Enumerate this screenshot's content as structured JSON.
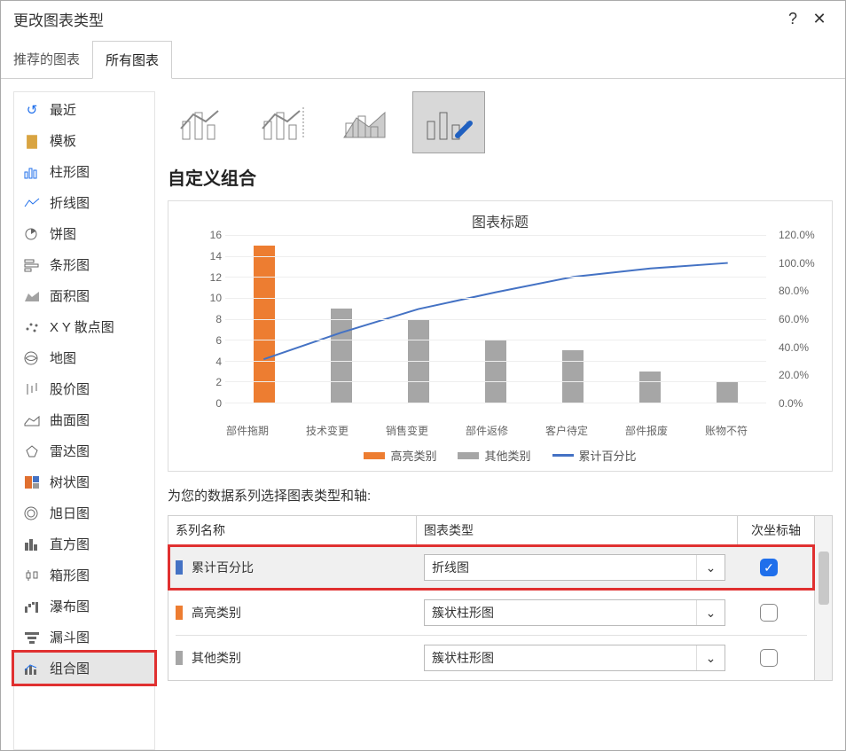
{
  "window": {
    "title": "更改图表类型",
    "help": "?",
    "close": "✕"
  },
  "tabs": {
    "recommended": "推荐的图表",
    "all": "所有图表"
  },
  "sidebar": {
    "items": [
      {
        "label": "最近",
        "key": "recent"
      },
      {
        "label": "模板",
        "key": "templates"
      },
      {
        "label": "柱形图",
        "key": "column"
      },
      {
        "label": "折线图",
        "key": "line"
      },
      {
        "label": "饼图",
        "key": "pie"
      },
      {
        "label": "条形图",
        "key": "bar"
      },
      {
        "label": "面积图",
        "key": "area"
      },
      {
        "label": "X Y 散点图",
        "key": "scatter"
      },
      {
        "label": "地图",
        "key": "map"
      },
      {
        "label": "股价图",
        "key": "stock"
      },
      {
        "label": "曲面图",
        "key": "surface"
      },
      {
        "label": "雷达图",
        "key": "radar"
      },
      {
        "label": "树状图",
        "key": "treemap"
      },
      {
        "label": "旭日图",
        "key": "sunburst"
      },
      {
        "label": "直方图",
        "key": "histogram"
      },
      {
        "label": "箱形图",
        "key": "box"
      },
      {
        "label": "瀑布图",
        "key": "waterfall"
      },
      {
        "label": "漏斗图",
        "key": "funnel"
      },
      {
        "label": "组合图",
        "key": "combo"
      }
    ]
  },
  "section_title": "自定义组合",
  "preview": {
    "title": "图表标题",
    "legend": {
      "highlight": "高亮类别",
      "other": "其他类别",
      "cum": "累计百分比"
    }
  },
  "series_section": {
    "label": "为您的数据系列选择图表类型和轴:",
    "headers": {
      "name": "系列名称",
      "type": "图表类型",
      "secondary": "次坐标轴"
    },
    "rows": [
      {
        "name": "累计百分比",
        "type": "折线图",
        "secondary": true,
        "color": "#4472c4",
        "highlight": true
      },
      {
        "name": "高亮类别",
        "type": "簇状柱形图",
        "secondary": false,
        "color": "#ed7d31"
      },
      {
        "name": "其他类别",
        "type": "簇状柱形图",
        "secondary": false,
        "color": "#a6a6a6"
      }
    ]
  },
  "chart_data": {
    "type": "combo",
    "title": "图表标题",
    "categories": [
      "部件拖期",
      "技术变更",
      "销售变更",
      "部件返修",
      "客户待定",
      "部件报废",
      "账物不符"
    ],
    "y_left": {
      "min": 0,
      "max": 16,
      "ticks": [
        0,
        2,
        4,
        6,
        8,
        10,
        12,
        14,
        16
      ]
    },
    "y_right": {
      "min": 0,
      "max": 1.2,
      "ticks": [
        "0.0%",
        "20.0%",
        "40.0%",
        "60.0%",
        "80.0%",
        "100.0%",
        "120.0%"
      ]
    },
    "series": [
      {
        "name": "高亮类别",
        "type": "bar",
        "axis": "left",
        "color": "#ed7d31",
        "values": [
          15,
          0,
          0,
          0,
          0,
          0,
          0
        ]
      },
      {
        "name": "其他类别",
        "type": "bar",
        "axis": "left",
        "color": "#a6a6a6",
        "values": [
          0,
          9,
          8,
          6,
          5,
          3,
          2
        ]
      },
      {
        "name": "累计百分比",
        "type": "line",
        "axis": "right",
        "color": "#4472c4",
        "values": [
          0.31,
          0.5,
          0.67,
          0.79,
          0.9,
          0.96,
          1.0
        ]
      }
    ]
  }
}
